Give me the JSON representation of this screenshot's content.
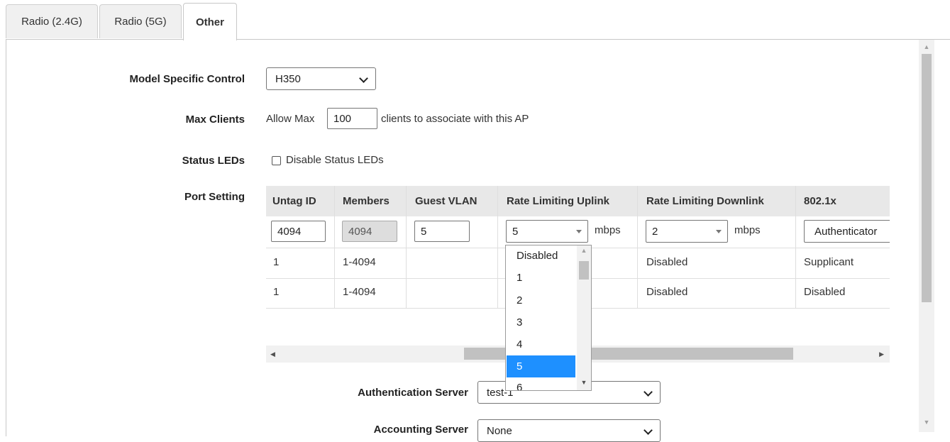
{
  "tabs": [
    {
      "label": "Radio (2.4G)"
    },
    {
      "label": "Radio (5G)"
    },
    {
      "label": "Other",
      "active": true
    }
  ],
  "model_specific_control": {
    "label": "Model Specific Control",
    "value": "H350"
  },
  "max_clients": {
    "label": "Max Clients",
    "prefix": "Allow Max",
    "value": "100",
    "suffix": "clients to associate with this AP"
  },
  "status_leds": {
    "label": "Status LEDs",
    "checkbox_label": "Disable Status LEDs",
    "checked": false
  },
  "port_setting": {
    "label": "Port Setting",
    "columns": [
      "Untag ID",
      "Members",
      "Guest VLAN",
      "Rate Limiting Uplink",
      "Rate Limiting Downlink",
      "802.1x"
    ],
    "edit_row": {
      "untag_id": "4094",
      "members": "4094",
      "guest_vlan": "5",
      "uplink": "5",
      "uplink_unit": "mbps",
      "downlink": "2",
      "downlink_unit": "mbps",
      "dot1x": "Authenticator"
    },
    "rows": [
      {
        "untag_id": "1",
        "members": "1-4094",
        "guest_vlan": "",
        "downlink": "Disabled",
        "dot1x": "Supplicant"
      },
      {
        "untag_id": "1",
        "members": "1-4094",
        "guest_vlan": "",
        "downlink": "Disabled",
        "dot1x": "Disabled"
      }
    ]
  },
  "uplink_dropdown": {
    "options": [
      "Disabled",
      "1",
      "2",
      "3",
      "4",
      "5",
      "6"
    ],
    "selected": "5"
  },
  "authentication_server": {
    "label": "Authentication Server",
    "value": "test-1"
  },
  "accounting_server": {
    "label": "Accounting Server",
    "value": "None"
  }
}
